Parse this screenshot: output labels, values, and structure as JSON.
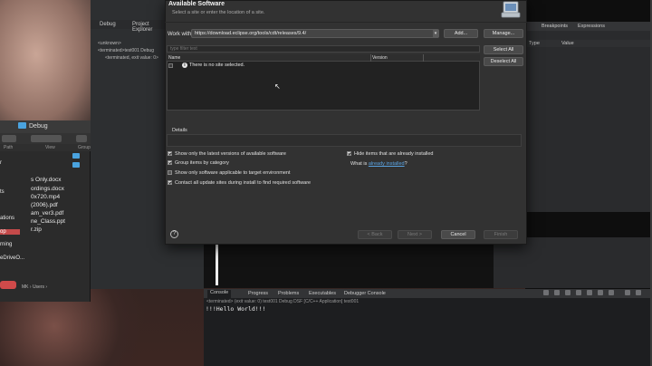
{
  "dialog": {
    "title": "Available Software",
    "subtitle": "Select a site or enter the location of a site.",
    "work_with_label": "Work with:",
    "work_with_value": "https://download.eclipse.org/tools/cdt/releases/9.4/",
    "add_button": "Add...",
    "manage_button": "Manage...",
    "filter_placeholder": "type filter text",
    "select_all_button": "Select All",
    "deselect_all_button": "Deselect All",
    "table_columns": [
      "Name",
      "Version"
    ],
    "table_message": "There is no site selected.",
    "details_label": "Details",
    "options_left": [
      {
        "label": "Show only the latest versions of available software",
        "checked": true
      },
      {
        "label": "Group items by category",
        "checked": true
      },
      {
        "label": "Show only software applicable to target environment",
        "checked": false
      },
      {
        "label": "Contact all update sites during install to find required software",
        "checked": true
      }
    ],
    "options_right": [
      {
        "label": "Hide items that are already installed",
        "checked": true
      }
    ],
    "what_is_prefix": "What is ",
    "what_is_link": "already installed",
    "what_is_suffix": "?",
    "cancel_button": "Cancel",
    "back_button": "< Back",
    "next_button": "Next >",
    "finish_button": "Finish",
    "help_icon": "?"
  },
  "eclipse": {
    "tabs": [
      "Debug",
      "Project Explorer"
    ],
    "debug_tree": [
      "<unknown>",
      "<terminated>test001 Debug",
      "<terminated, exit value: 0>"
    ],
    "right_tabs": [
      "Breakpoints",
      "Expressions"
    ],
    "var_columns": [
      "Type",
      "Value"
    ],
    "console_tabs": [
      "Console",
      "Progress",
      "Problems",
      "Executables",
      "Debugger Console"
    ],
    "console_status": "<terminated> (exit value: 0) test001 Debug DSF [C/C++ Application] test001",
    "console_output": "!!!Hello World!!!"
  },
  "finder": {
    "title": "Debug",
    "columns": [
      "Path",
      "View",
      "Group"
    ],
    "sidebar": [
      "r",
      "ts",
      "ations",
      "op",
      "rning",
      "eDriveO..."
    ],
    "files": [
      "s Only.docx",
      "ordings.docx",
      "0x720.mp4",
      "(2006).pdf",
      "am_ver3.pdf",
      "ne_Class.ppt",
      "r.zip"
    ],
    "path": "MK › Users › "
  },
  "colors": {
    "dialog_bg": "#323232",
    "link": "#5aa2e0",
    "finder_selection": "#c44a4a",
    "folder": "#4aa3df"
  }
}
